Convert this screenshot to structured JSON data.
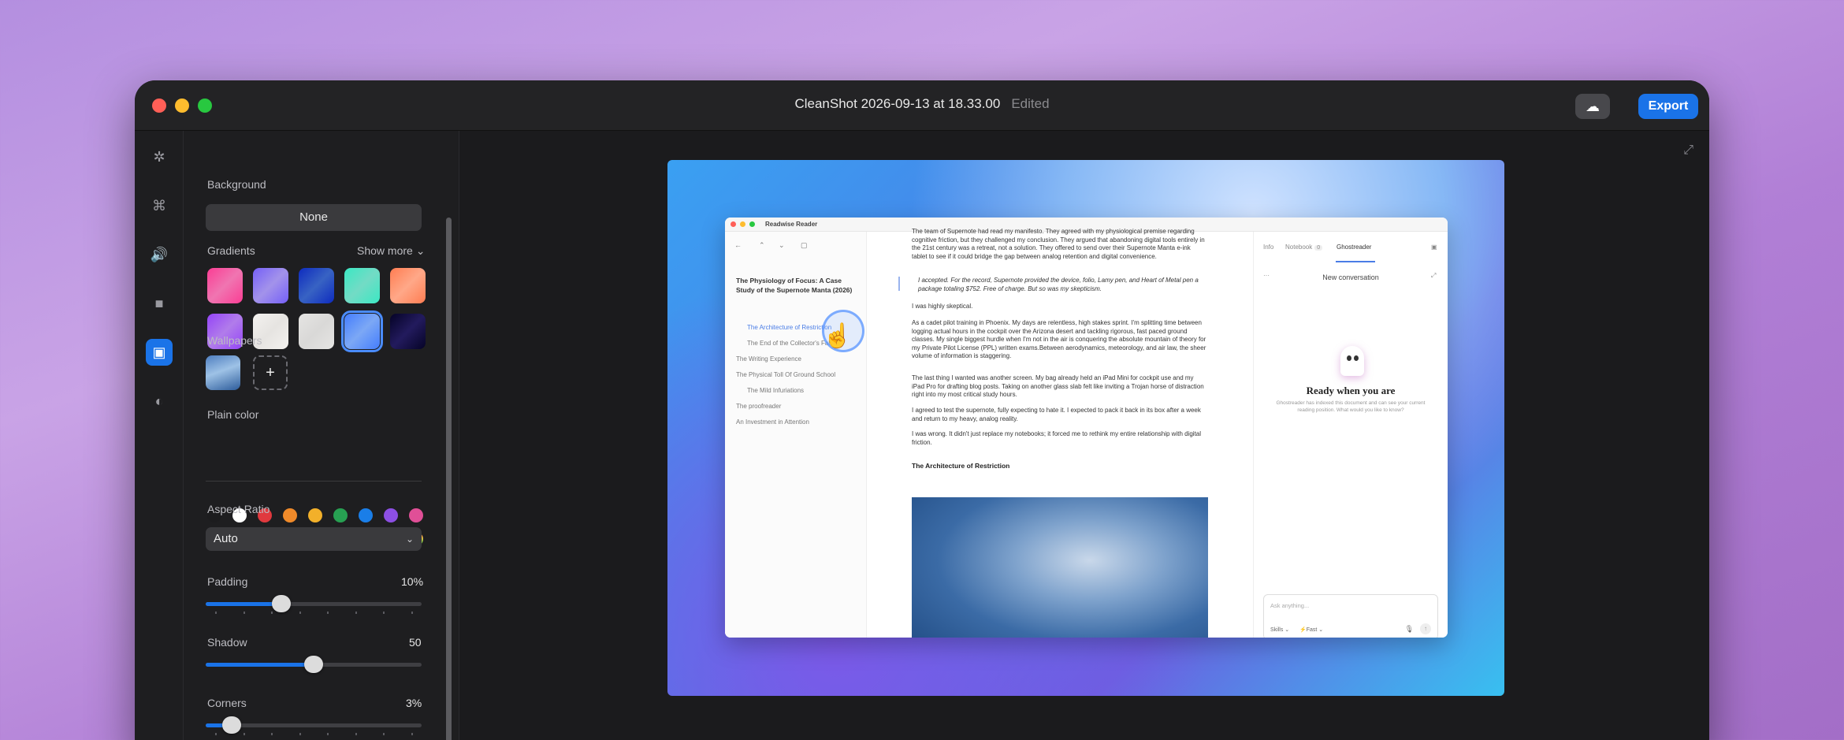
{
  "window": {
    "title": "CleanShot 2026-09-13 at 18.33.00",
    "status": "Edited",
    "export_label": "Export",
    "cloud_icon": "cloud-upload-icon"
  },
  "rail": {
    "items": [
      "magic-wand-icon",
      "crop-icon",
      "audio-icon",
      "camera-icon",
      "background-icon",
      "toggle-icon"
    ],
    "active_index": 4
  },
  "panel": {
    "background_label": "Background",
    "background_value": "None",
    "gradients_label": "Gradients",
    "show_more_label": "Show more",
    "gradients": [
      "#e8588a",
      "#7a6ee0",
      "#2a4aa5",
      "#56c9a8",
      "#ff7e66",
      "#8a5de0",
      "#d9d6d2",
      "#c6c5c3",
      "#5d7ef0",
      "#1a1446"
    ],
    "selected_gradient_index": 8,
    "wallpapers_label": "Wallpapers",
    "plain_color_label": "Plain color",
    "colors_row1": [
      "#1c1c1e",
      "#ffffff",
      "#e0393e",
      "#f08a2a",
      "#f2b02a",
      "#27a052",
      "#1a7ee8",
      "#8c4fe3",
      "#e04f97"
    ],
    "colors_row2": [
      "#3a3a3c",
      "#e8e8e8",
      "#f2a6a0",
      "#f5c282",
      "#f7d98a",
      "#9fe0b0",
      "#9cc6f2",
      "#c7a8ee",
      "#rainbow"
    ],
    "aspect_ratio_label": "Aspect Ratio",
    "aspect_ratio_value": "Auto",
    "padding_label": "Padding",
    "padding_value": "10%",
    "padding_level": 0.35,
    "shadow_label": "Shadow",
    "shadow_value": "50",
    "shadow_level": 0.5,
    "corners_label": "Corners",
    "corners_value": "3%",
    "corners_level": 0.12
  },
  "reader": {
    "app_title": "Readwise Reader",
    "toc_title": "The Physiology of Focus: A Case Study of the Supernote Manta (2026)",
    "toc": [
      {
        "label": "The Architecture of Restriction",
        "current": true,
        "indent": true
      },
      {
        "label": "The End of the Collector's Fallacy",
        "current": false,
        "indent": true
      },
      {
        "label": "The Writing Experience",
        "current": false,
        "indent": false
      },
      {
        "label": "The Physical Toll Of Ground School",
        "current": false,
        "indent": false
      },
      {
        "label": "The Mild Infuriations",
        "current": false,
        "indent": true
      },
      {
        "label": "The proofreader",
        "current": false,
        "indent": false
      },
      {
        "label": "An Investment in Attention",
        "current": false,
        "indent": false
      }
    ],
    "paragraphs": [
      "The team of Supernote had read my manifesto. They agreed with my physiological premise regarding cognitive friction, but they challenged my conclusion. They argued that abandoning digital tools entirely in the 21st century was a retreat, not a solution. They offered to send over their Supernote Manta e-ink tablet to see if it could bridge the gap between analog retention and digital convenience.",
      "I accepted. For the record, Supernote provided the device, folio, Lamy pen, and Heart of Metal pen a package totaling $752. Free of charge. But so was my skepticism.",
      "I was highly skeptical.",
      "As a cadet pilot training in Phoenix. My days are relentless, high stakes sprint. I'm splitting time between logging actual hours in the cockpit over the Arizona desert and tackling rigorous, fast paced ground classes. My single biggest hurdle when I'm not in the air is conquering the absolute mountain of theory for my Private Pilot License (PPL) written exams.Between aerodynamics, meteorology, and air law, the sheer volume of information is staggering.",
      "The last thing I wanted was another screen. My bag already held an iPad Mini for cockpit use and my iPad Pro for drafting blog posts. Taking on another glass slab felt like inviting a Trojan horse of distraction right into my most critical study hours.",
      "I agreed to test the supernote, fully expecting to hate it. I expected to pack it back in its box after a week and return to my heavy, analog reality.",
      "I was wrong. It didn't just replace my notebooks; it forced me to rethink my entire relationship with digital friction."
    ],
    "section_heading": "The Architecture of Restriction",
    "tabs": [
      "Info",
      "Notebook",
      "Ghostreader"
    ],
    "notebook_count": "0",
    "new_conversation": "New conversation",
    "more_icon": "ellipsis-icon",
    "ready_title": "Ready when you are",
    "ready_sub": "Ghostreader has indexed this document and can see your current reading position. What would you like to know?",
    "ask_placeholder": "Ask anything...",
    "skills_label": "Skills",
    "fast_label": "Fast"
  }
}
